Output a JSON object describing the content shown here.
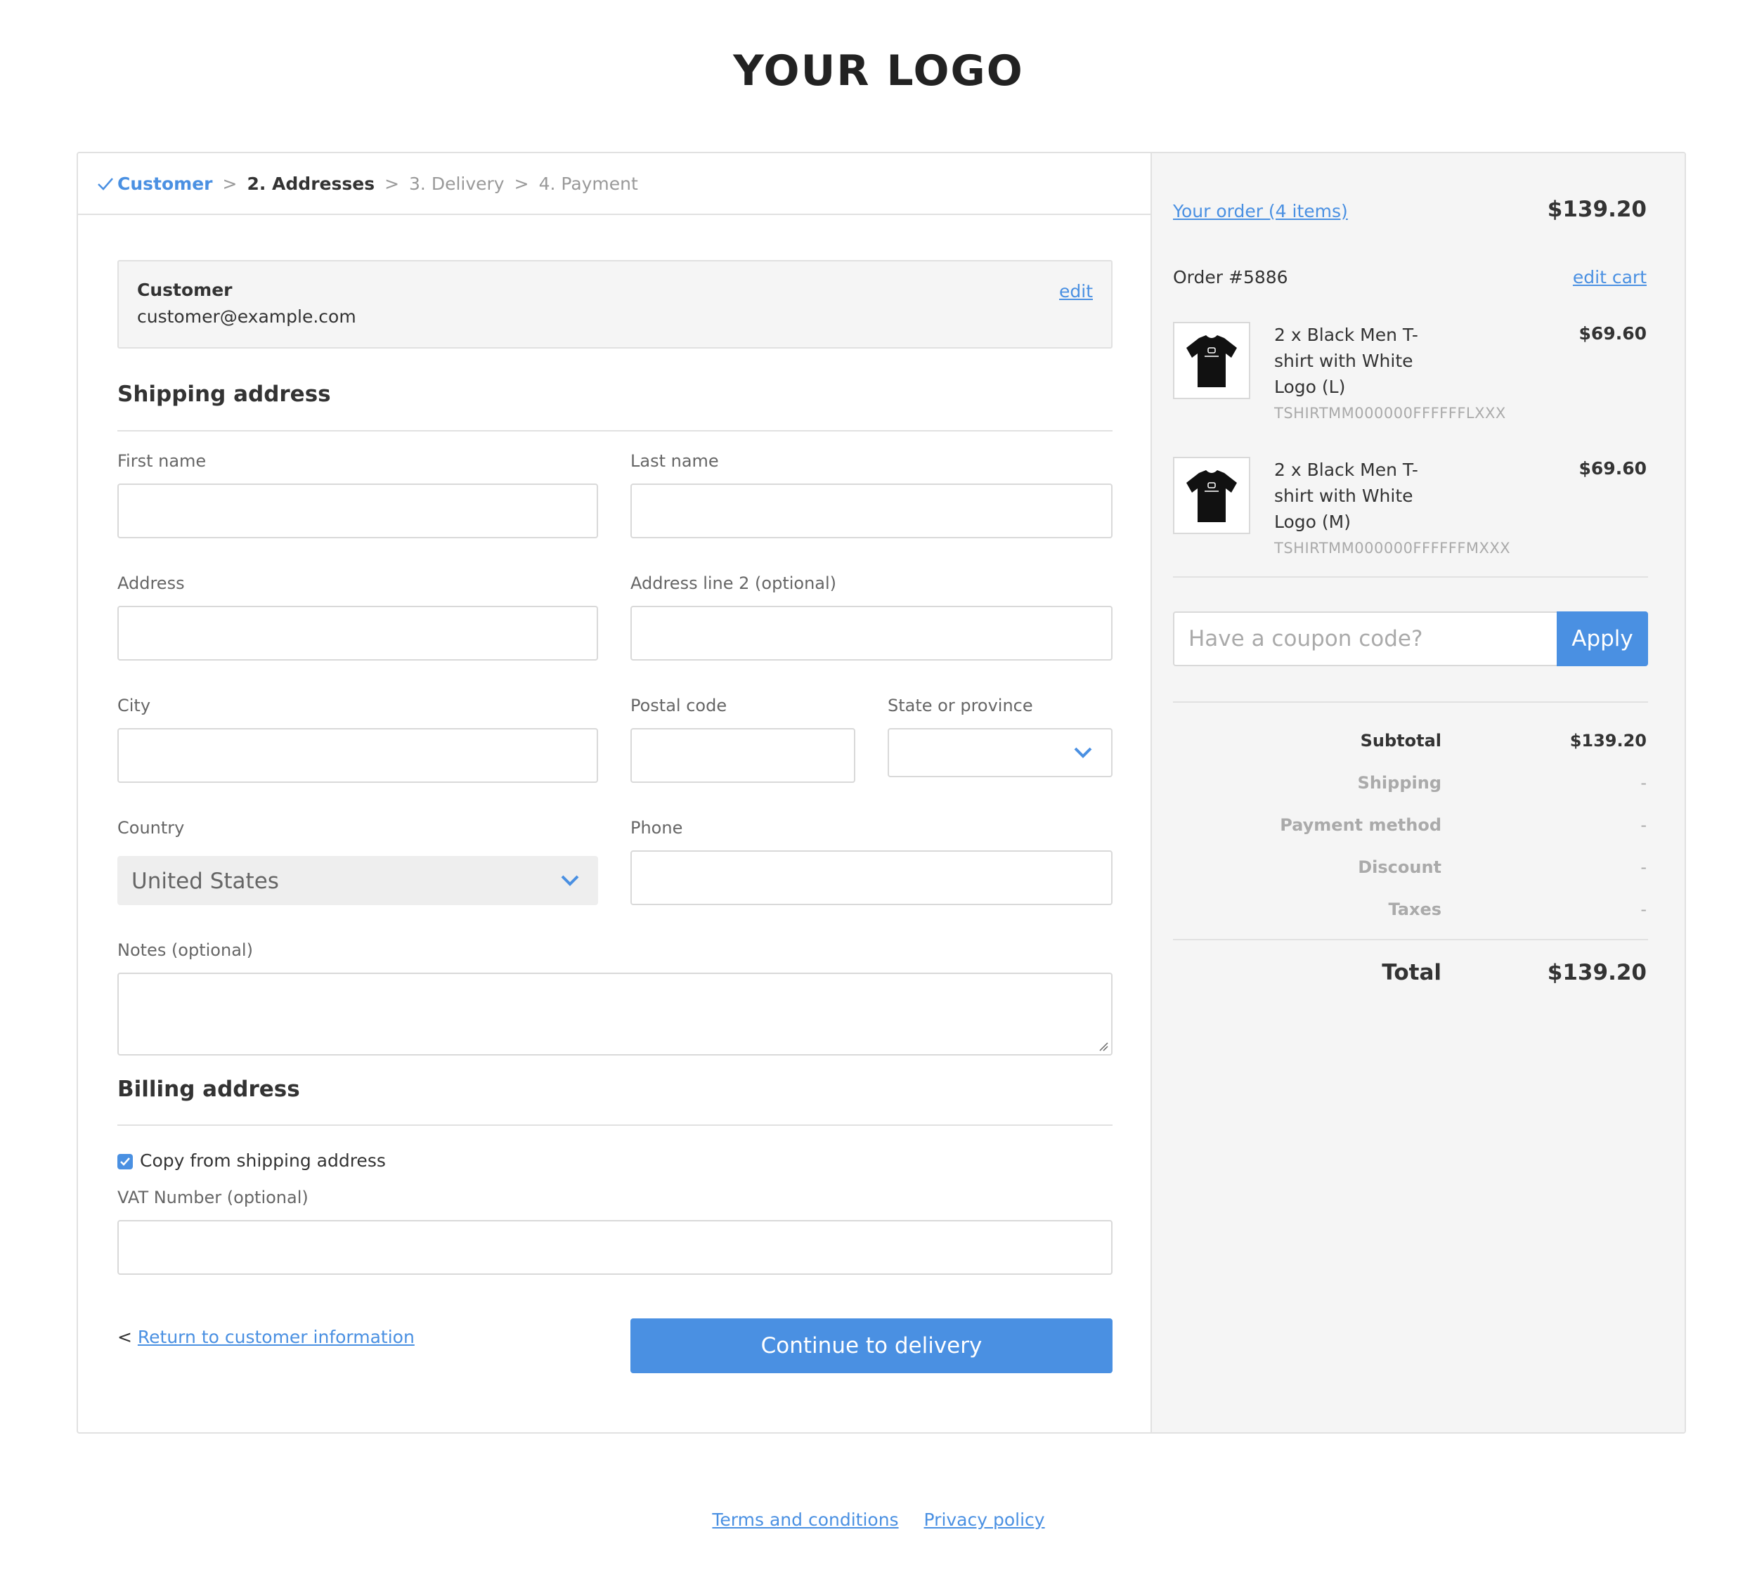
{
  "logo": "YOUR LOGO",
  "steps": {
    "customer": "Customer",
    "separator": ">",
    "addresses": "2. Addresses",
    "delivery": "3. Delivery",
    "payment": "4. Payment"
  },
  "customer_box": {
    "title": "Customer",
    "email": "customer@example.com",
    "edit": "edit"
  },
  "shipping": {
    "title": "Shipping address",
    "first_name": "First name",
    "last_name": "Last name",
    "address": "Address",
    "address2": "Address line 2 (optional)",
    "city": "City",
    "postal_code": "Postal code",
    "state": "State or province",
    "country_label": "Country",
    "country_value": "United States",
    "phone": "Phone",
    "notes": "Notes (optional)"
  },
  "billing": {
    "title": "Billing address",
    "copy_checkbox": "Copy from shipping address",
    "copy_checked": true,
    "vat": "VAT Number (optional)"
  },
  "actions": {
    "back_prefix": "<",
    "back_link": "Return to customer information",
    "continue": "Continue to delivery"
  },
  "summary": {
    "your_order": "Your order (4 items)",
    "order_total_top": "$139.20",
    "order_number": "Order #5886",
    "edit_cart": "edit cart",
    "items": [
      {
        "name": "2 x Black Men T-shirt with White Logo (L)",
        "sku": "TSHIRTMM000000FFFFFFLXXX",
        "price": "$69.60",
        "icon": "tshirt-icon"
      },
      {
        "name": "2 x Black Men T-shirt with White Logo (M)",
        "sku": "TSHIRTMM000000FFFFFFMXXX",
        "price": "$69.60",
        "icon": "tshirt-icon"
      }
    ],
    "coupon_placeholder": "Have a coupon code?",
    "apply": "Apply",
    "subtotal_label": "Subtotal",
    "subtotal_value": "$139.20",
    "shipping_label": "Shipping",
    "shipping_value": "-",
    "payment_label": "Payment method",
    "payment_value": "-",
    "discount_label": "Discount",
    "discount_value": "-",
    "taxes_label": "Taxes",
    "taxes_value": "-",
    "total_label": "Total",
    "total_value": "$139.20"
  },
  "footer": {
    "terms": "Terms and conditions",
    "privacy": "Privacy policy"
  },
  "colors": {
    "accent": "#4a90e2",
    "panel_bg": "#f5f5f5",
    "border": "#e1e1e1"
  }
}
